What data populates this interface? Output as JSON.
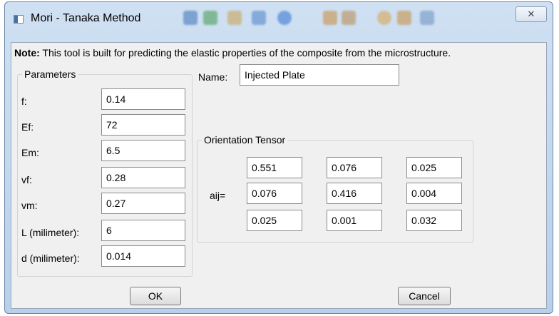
{
  "window": {
    "title": "Mori - Tanaka Method",
    "close_glyph": "✕"
  },
  "note": {
    "label": "Note:",
    "text": "This tool is built for predicting the elastic properties of the composite from the microstructure."
  },
  "parameters": {
    "group_label": "Parameters",
    "fields": [
      {
        "label": "f:",
        "value": "0.14"
      },
      {
        "label": "Ef:",
        "value": "72"
      },
      {
        "label": "Em:",
        "value": "6.5"
      },
      {
        "label": "vf:",
        "value": "0.28"
      },
      {
        "label": "vm:",
        "value": "0.27"
      },
      {
        "label": "L (milimeter):",
        "value": "6"
      },
      {
        "label": "d (milimeter):",
        "value": "0.014"
      }
    ]
  },
  "name": {
    "label": "Name:",
    "value": "Injected Plate"
  },
  "orientation": {
    "group_label": "Orientation Tensor",
    "row_label": "aij=",
    "matrix": [
      [
        "0.551",
        "0.076",
        "0.025"
      ],
      [
        "0.076",
        "0.416",
        "0.004"
      ],
      [
        "0.025",
        "0.001",
        "0.032"
      ]
    ]
  },
  "buttons": {
    "ok": "OK",
    "cancel": "Cancel"
  }
}
